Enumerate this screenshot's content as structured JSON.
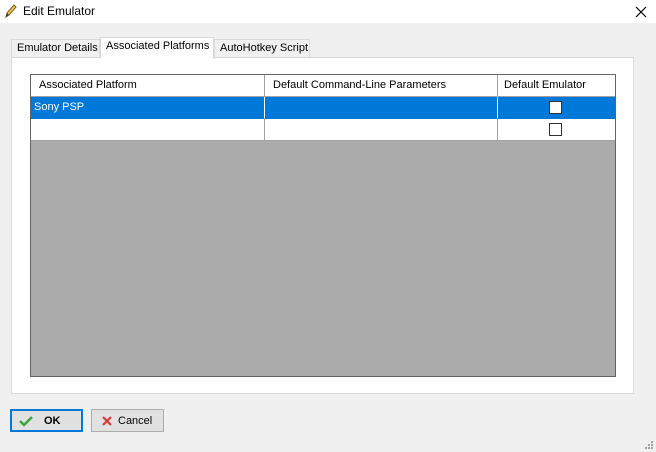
{
  "window": {
    "title": "Edit Emulator"
  },
  "tabs": [
    {
      "label": "Emulator Details",
      "active": false
    },
    {
      "label": "Associated Platforms",
      "active": true
    },
    {
      "label": "AutoHotkey Script",
      "active": false
    }
  ],
  "grid": {
    "columns": [
      "Associated Platform",
      "Default Command-Line Parameters",
      "Default Emulator"
    ],
    "rows": [
      {
        "platform": "Sony PSP",
        "parameters": "",
        "default": false,
        "selected": true
      },
      {
        "platform": "",
        "parameters": "",
        "default": false,
        "selected": false
      }
    ]
  },
  "buttons": {
    "ok": "OK",
    "cancel": "Cancel"
  },
  "colors": {
    "selection": "#0078d7",
    "grid_background": "#ababab",
    "ok_icon": "#3aa63a",
    "cancel_icon": "#d93a3a"
  },
  "icons": {
    "title": "pencil-icon",
    "close": "close-icon",
    "ok": "checkmark-icon",
    "cancel": "x-icon"
  }
}
